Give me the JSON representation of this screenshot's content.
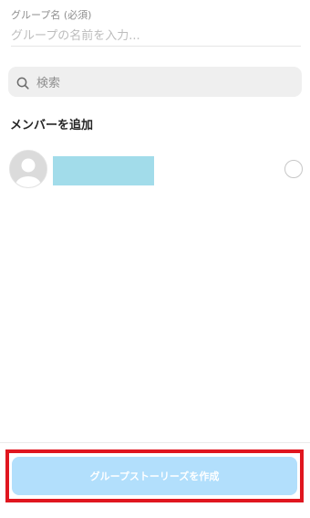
{
  "group_name": {
    "label": "グループ名 (必須)",
    "placeholder": "グループの名前を入力..."
  },
  "search": {
    "placeholder": "検索",
    "icon": "search-icon"
  },
  "members_section": {
    "title": "メンバーを追加",
    "members": [
      {
        "avatar": "default-avatar",
        "name_redacted_color": "#a2dcea",
        "selected": false
      }
    ]
  },
  "footer": {
    "create_button_label": "グループストーリーズを作成",
    "button_color": "#b2dffc",
    "highlight_color": "#e0161f"
  }
}
